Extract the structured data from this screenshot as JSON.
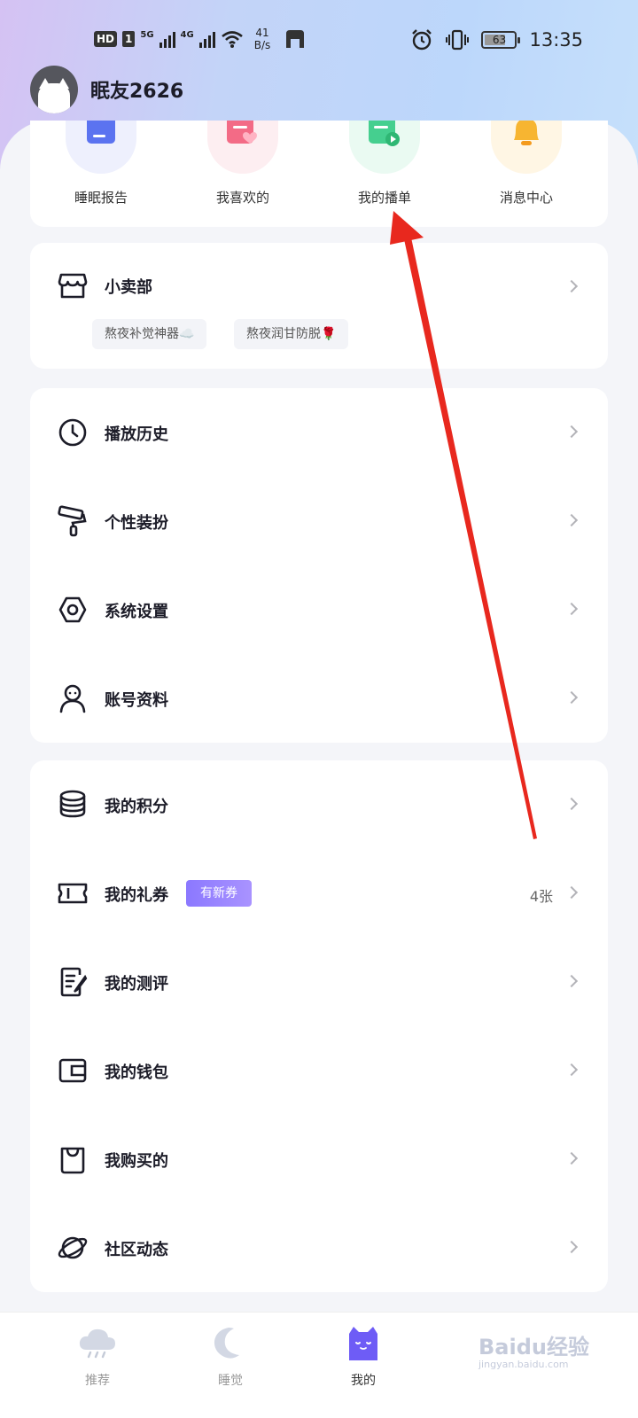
{
  "status_bar": {
    "hd": "HD",
    "sim": "1",
    "net1": "5G",
    "net2": "4G",
    "speed_value": "41",
    "speed_unit": "B/s",
    "battery": "63",
    "time": "13:35"
  },
  "profile": {
    "username": "眠友2626"
  },
  "quick_actions": [
    {
      "label": "睡眠报告",
      "icon": "sleep-report-icon",
      "color": "#4f6bf2"
    },
    {
      "label": "我喜欢的",
      "icon": "favorite-icon",
      "color": "#f0607e"
    },
    {
      "label": "我的播单",
      "icon": "playlist-icon",
      "color": "#3fcf8e"
    },
    {
      "label": "消息中心",
      "icon": "bell-icon",
      "color": "#f6b73c"
    }
  ],
  "shop": {
    "title": "小卖部",
    "tags": [
      "熬夜补觉神器☁️",
      "熬夜润甘防脱🌹"
    ]
  },
  "menu_group_1": [
    {
      "label": "播放历史",
      "icon": "clock-icon"
    },
    {
      "label": "个性装扮",
      "icon": "paint-roller-icon"
    },
    {
      "label": "系统设置",
      "icon": "settings-icon"
    },
    {
      "label": "账号资料",
      "icon": "user-icon"
    }
  ],
  "menu_group_2": [
    {
      "label": "我的积分",
      "icon": "coins-icon"
    },
    {
      "label": "我的礼券",
      "icon": "ticket-icon",
      "badge": "有新券",
      "value": "4张"
    },
    {
      "label": "我的测评",
      "icon": "assessment-icon"
    },
    {
      "label": "我的钱包",
      "icon": "wallet-icon"
    },
    {
      "label": "我购买的",
      "icon": "shopping-bag-icon"
    },
    {
      "label": "社区动态",
      "icon": "planet-icon"
    }
  ],
  "tabbar": [
    {
      "label": "推荐",
      "icon": "cloud-rain-icon",
      "active": false
    },
    {
      "label": "睡觉",
      "icon": "moon-icon",
      "active": false
    },
    {
      "label": "我的",
      "icon": "cat-icon",
      "active": true
    }
  ],
  "watermark": {
    "text": "Baidu经验",
    "sub": "jingyan.baidu.com"
  }
}
